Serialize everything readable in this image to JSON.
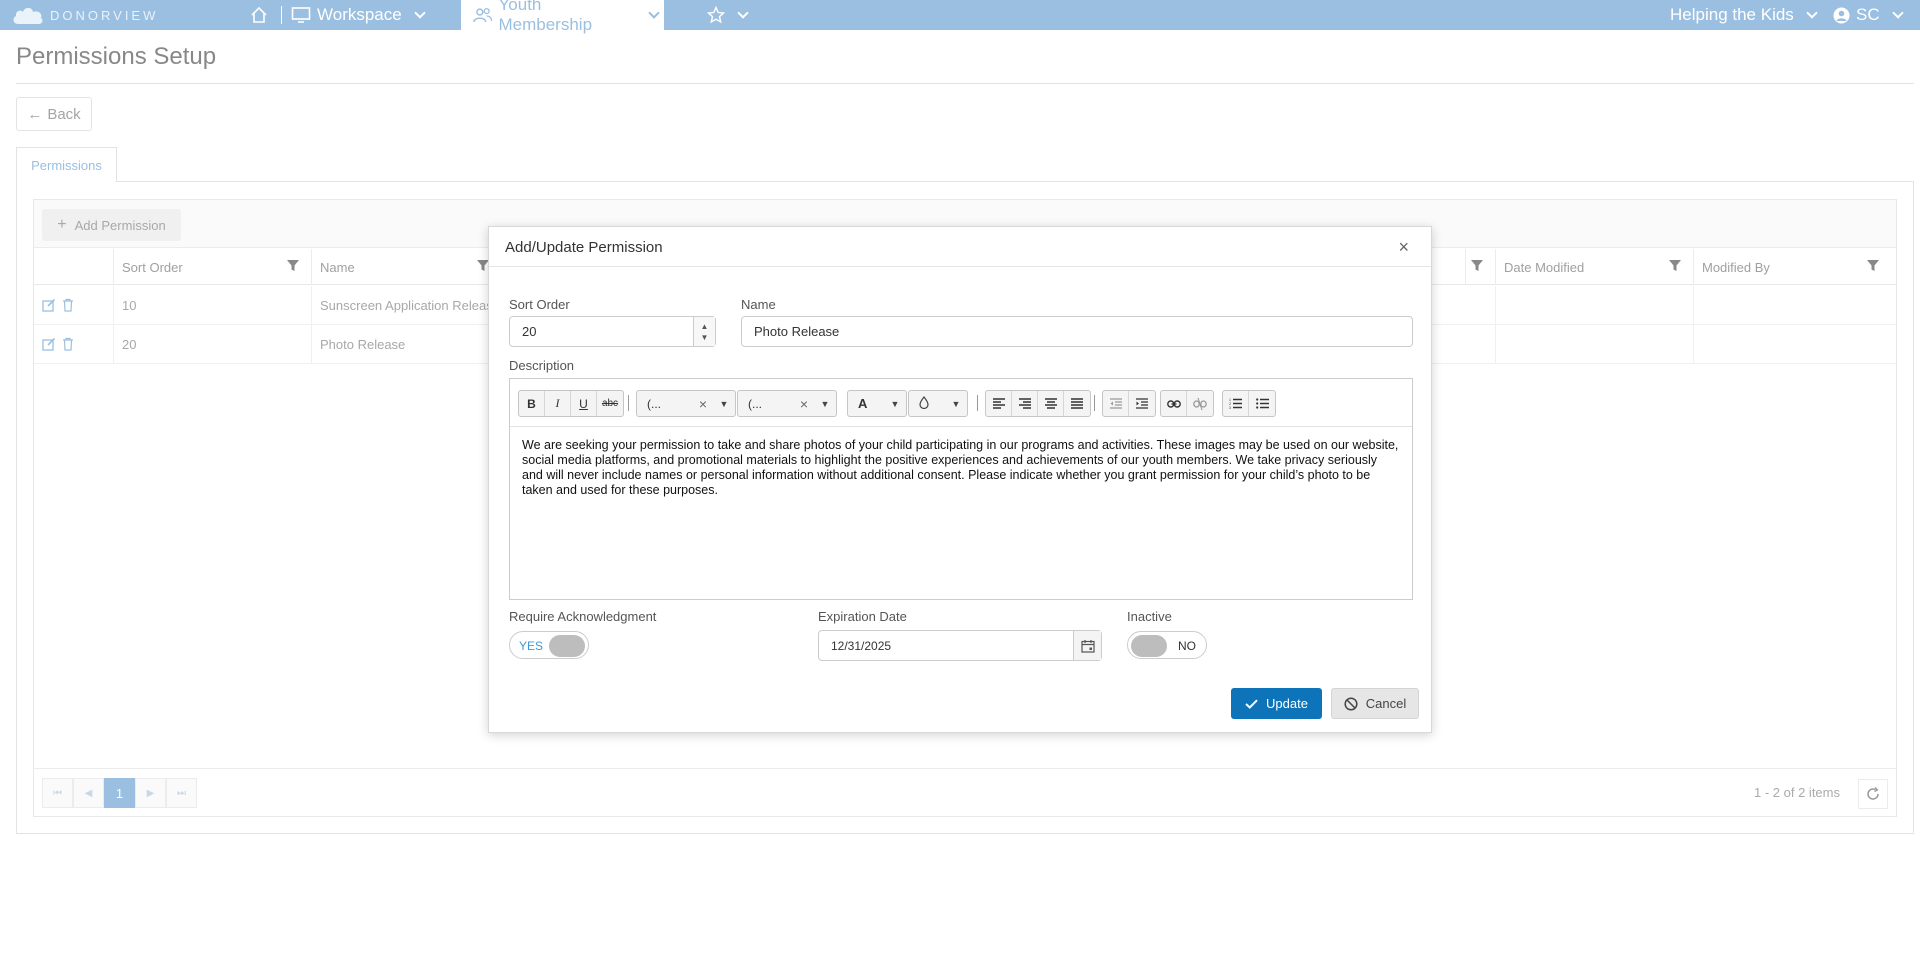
{
  "topbar": {
    "brand": "DONORVIEW",
    "workspace_label": "Workspace",
    "active_tab_label": "Youth Membership",
    "org_label": "Helping the Kids",
    "user_initials": "SC",
    "icons": [
      "cloud-logo-icon",
      "home-icon",
      "monitor-icon",
      "users-icon",
      "star-icon",
      "user-circle-icon"
    ]
  },
  "page": {
    "title": "Permissions Setup",
    "back_label": "Back",
    "tab_label": "Permissions"
  },
  "grid": {
    "add_label": "Add Permission",
    "columns": [
      "Sort Order",
      "Name",
      "Date Modified",
      "Modified By"
    ],
    "rows": [
      {
        "sort_order": "10",
        "name": "Sunscreen Application Release"
      },
      {
        "sort_order": "20",
        "name": "Photo Release"
      }
    ],
    "pager": {
      "current_page": "1",
      "info": "1 - 2 of 2 items"
    }
  },
  "dialog": {
    "title": "Add/Update Permission",
    "close_glyph": "×",
    "sort_order_label": "Sort Order",
    "sort_order_value": "20",
    "name_label": "Name",
    "name_value": "Photo Release",
    "description_label": "Description",
    "font_name_value": "(...",
    "font_size_value": "(...",
    "font_color_glyph": "A",
    "description_text": "We are seeking your permission to take and share photos of your child participating in our programs and activities. These images may be used on our website, social media platforms, and promotional materials to highlight the positive experiences and achievements of our youth members. We take privacy seriously and will never include names or personal information without additional consent. Please indicate whether you grant permission for your child’s photo to be taken and used for these purposes.",
    "require_ack_label": "Require Acknowledgment",
    "require_ack_state": "YES",
    "expiration_label": "Expiration Date",
    "expiration_value": "12/31/2025",
    "inactive_label": "Inactive",
    "inactive_state": "NO",
    "update_label": "Update",
    "cancel_label": "Cancel"
  },
  "colors": {
    "topbar": "#9bbfe0",
    "primary_button": "#0d74ba",
    "toggle_on_text": "#3a9ad9"
  }
}
